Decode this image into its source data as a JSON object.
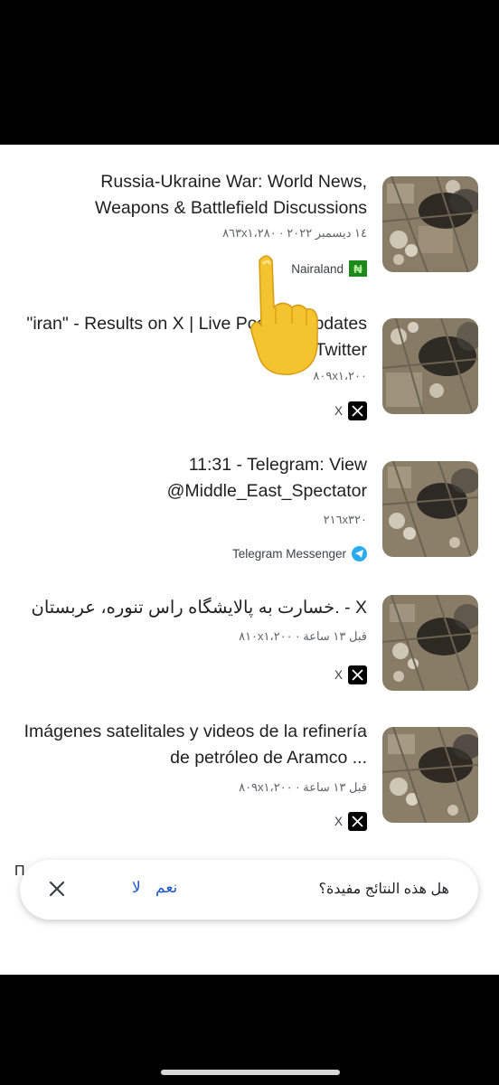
{
  "results": [
    {
      "title": "Russia-Ukraine War: World News, Weapons & Battlefield Discussions",
      "meta": "١٤ ديسمبر ٢٠٢٢ · ٨٦٣x١،٢٨٠",
      "source": "Nairaland",
      "source_icon": "nairaland-icon"
    },
    {
      "title": "\"iran\" - Results on X | Live Posts & Updates on Twitter",
      "meta": "٨٠٩x١،٢٠٠",
      "source": "X",
      "source_icon": "x-icon"
    },
    {
      "title": "11:31 - Telegram: View @Middle_East_Spectator",
      "meta": "٢١٦x٣٢٠",
      "source": "Telegram Messenger",
      "source_icon": "telegram-icon"
    },
    {
      "title": "خسارت به پالایشگاه راس تنوره، عربستان. - X",
      "meta": "قبل ١٣ ساعة · ٨١٠x١،٢٠٠",
      "source": "X",
      "source_icon": "x-icon"
    },
    {
      "title": "Imágenes satelitales y videos de la refinería de petróleo de Aramco ...",
      "meta": "قبل ١٣ ساعة · ٨٠٩x١،٢٠٠",
      "source": "X",
      "source_icon": "x-icon"
    }
  ],
  "feedback": {
    "question": "هل هذه النتائج مفيدة؟",
    "yes": "نعم",
    "no": "لا"
  },
  "stray_text": "П",
  "overlay": {
    "icon": "pointing-hand-emoji"
  }
}
